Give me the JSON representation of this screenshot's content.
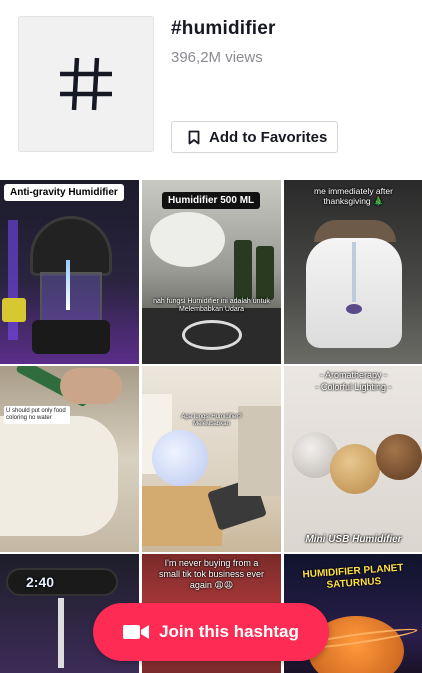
{
  "hashtag": {
    "title": "#humidifier",
    "views": "396,2M views",
    "favorite_label": "Add to Favorites"
  },
  "videos": [
    {
      "caption": "Anti-gravity Humidifier"
    },
    {
      "caption": "Humidifier 500 ML",
      "subcaption": "nah fungsi Humidifier ini adalah untuk Melembabkan Udara"
    },
    {
      "caption": "me immediately after thanksgiving 🎄"
    },
    {
      "caption": "U should put only food coloring no water"
    },
    {
      "caption": "Apa fungsi Humidifier? Meleмbabkan"
    },
    {
      "caption": "- Aromatherapy -",
      "subcaption": "- Colorful Lighting -",
      "footer": "Mini USB Humidifier"
    },
    {
      "caption": "2:40"
    },
    {
      "caption": "I'm never buying from a small tik tok business ever again 😩😩"
    },
    {
      "caption": "HUMIDIFIER PLANET SATURNUS"
    }
  ],
  "join_button": {
    "label": "Join this hashtag"
  },
  "colors": {
    "accent": "#fe2c55",
    "text": "#161823",
    "muted": "#8a8b91"
  }
}
